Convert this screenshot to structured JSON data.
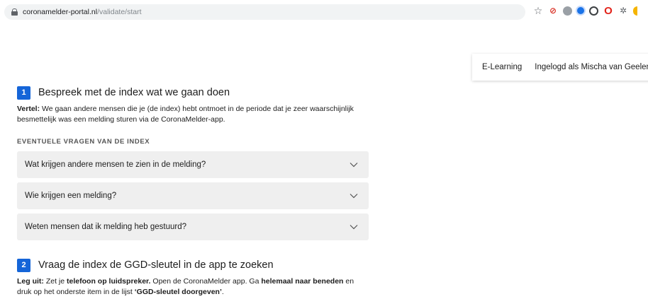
{
  "browser": {
    "url_host": "coronamelder-portal.nl",
    "url_path": "/validate/start",
    "extension_icons": [
      "star-icon",
      "blocked-icon",
      "cloud-icon",
      "blue-dot-icon",
      "circle-icon",
      "opera-icon",
      "bug-icon",
      "yellow-icon"
    ]
  },
  "topnav": {
    "elearning": "E-Learning",
    "logged_in": "Ingelogd als Mischa van Geelen"
  },
  "step1": {
    "number": "1",
    "title": "Bespreek met de index wat we gaan doen",
    "para_label": "Vertel:",
    "para_text": " We gaan andere mensen die je (de index) hebt ontmoet in de periode dat je zeer waarschijnlijk besmettelijk was een melding sturen via de CoronaMelder-app.",
    "questions_heading": "Eventuele vragen van de index",
    "questions": [
      "Wat krijgen andere mensen te zien in de melding?",
      "Wie krijgen een melding?",
      "Weten mensen dat ik melding heb gestuurd?"
    ]
  },
  "step2": {
    "number": "2",
    "title": "Vraag de index de GGD-sleutel in de app te zoeken",
    "label": "Leg uit:",
    "t1": " Zet je ",
    "b1": "telefoon op luidspreker.",
    "t2": " Open de CoronaMelder app. Ga ",
    "b2": "helemaal naar beneden",
    "t3": " en druk op het onderste item in de lijst ",
    "b3": "‘GGD-sleutel doorgeven’",
    "t4": "."
  },
  "colors": {
    "accent": "#1565d8",
    "accordion_bg": "#efefef"
  }
}
